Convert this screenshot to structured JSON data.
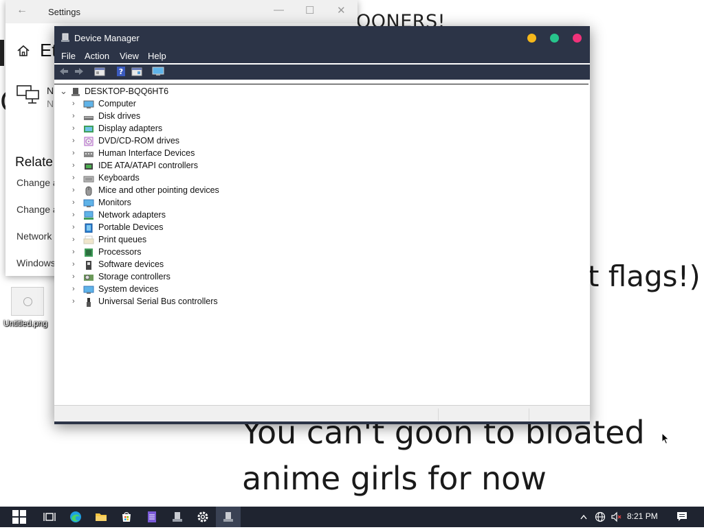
{
  "wallpaper": {
    "top_text": "OONERS!",
    "flags_text": "t flags!)",
    "message_line1": "You can't goon to bloated",
    "message_line2": "anime girls for now",
    "side_mark": "C"
  },
  "settings_window": {
    "title": "Settings",
    "back_glyph": "←",
    "heading": "Et",
    "network_name": "N",
    "network_sub": "N",
    "related_heading": "Relate",
    "links": [
      "Change a",
      "Change a",
      "Network",
      "Windows"
    ],
    "controls": {
      "minimize": "—",
      "maximize": "☐",
      "close": "✕"
    }
  },
  "desktop_icon": {
    "label": "Untitled.png"
  },
  "device_manager": {
    "title": "Device Manager",
    "menu": [
      "File",
      "Action",
      "View",
      "Help"
    ],
    "toolbar_icons": [
      "back-arrow-icon",
      "forward-arrow-icon",
      "properties-icon",
      "help-icon",
      "details-icon",
      "monitor-icon"
    ],
    "root": "DESKTOP-BQQ6HT6",
    "root_chevron": "⌄",
    "chevron": "›",
    "categories": [
      {
        "label": "Computer",
        "icon": "computer-icon"
      },
      {
        "label": "Disk drives",
        "icon": "disk-drive-icon"
      },
      {
        "label": "Display adapters",
        "icon": "display-adapter-icon"
      },
      {
        "label": "DVD/CD-ROM drives",
        "icon": "dvd-drive-icon"
      },
      {
        "label": "Human Interface Devices",
        "icon": "hid-icon"
      },
      {
        "label": "IDE ATA/ATAPI controllers",
        "icon": "ide-controller-icon"
      },
      {
        "label": "Keyboards",
        "icon": "keyboard-icon"
      },
      {
        "label": "Mice and other pointing devices",
        "icon": "mouse-icon"
      },
      {
        "label": "Monitors",
        "icon": "monitor-icon"
      },
      {
        "label": "Network adapters",
        "icon": "network-adapter-icon"
      },
      {
        "label": "Portable Devices",
        "icon": "portable-device-icon"
      },
      {
        "label": "Print queues",
        "icon": "printer-icon"
      },
      {
        "label": "Processors",
        "icon": "processor-icon"
      },
      {
        "label": "Software devices",
        "icon": "software-device-icon"
      },
      {
        "label": "Storage controllers",
        "icon": "storage-controller-icon"
      },
      {
        "label": "System devices",
        "icon": "system-device-icon"
      },
      {
        "label": "Universal Serial Bus controllers",
        "icon": "usb-icon"
      }
    ],
    "title_buttons": {
      "minimize_color": "#f6b81b",
      "maximize_color": "#27c58c",
      "close_color": "#f0327a"
    }
  },
  "taskbar": {
    "start_icon": "windows-start-icon",
    "apps": [
      "task-view-icon",
      "edge-icon",
      "file-explorer-icon",
      "store-icon",
      "notepad-icon",
      "device-manager-icon",
      "settings-icon",
      "device-manager-active-icon"
    ],
    "tray": [
      "chevron-up-icon",
      "globe-icon",
      "speaker-muted-icon",
      "notifications-icon"
    ],
    "time": "8:21 PM"
  }
}
